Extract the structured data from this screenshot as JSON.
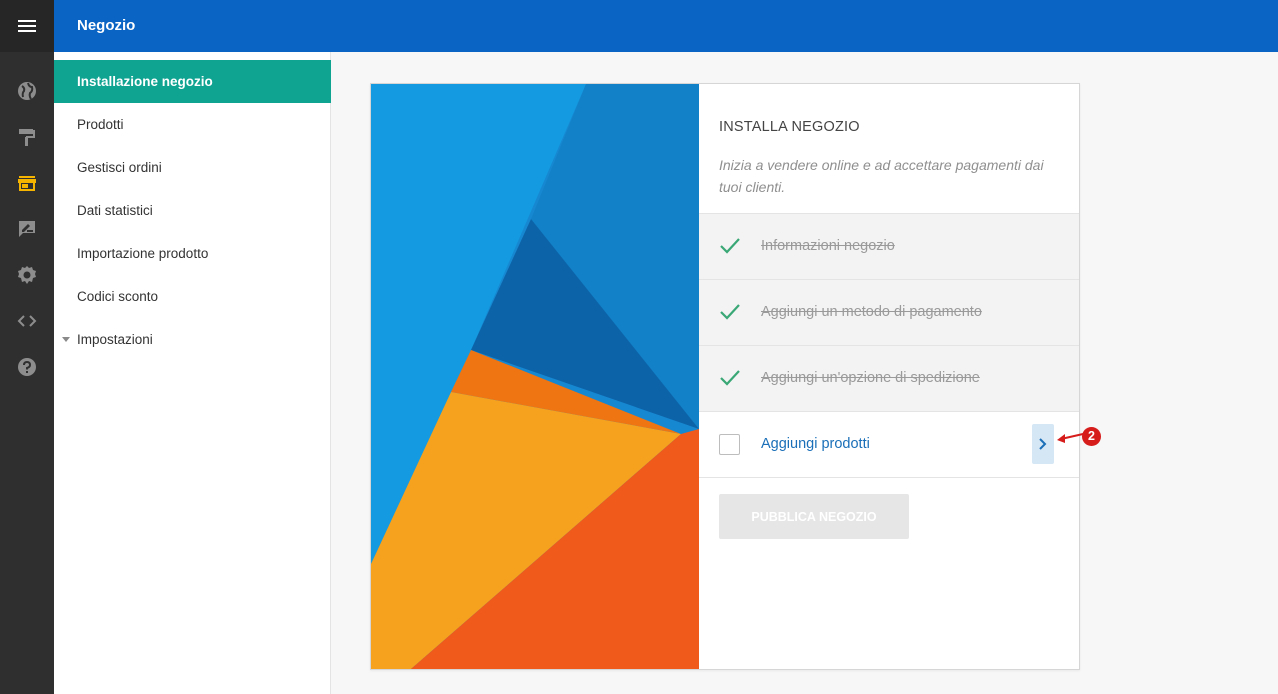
{
  "topbar": {
    "title": "Negozio"
  },
  "rail": {
    "items": [
      {
        "icon": "menu-icon"
      },
      {
        "icon": "globe-icon"
      },
      {
        "icon": "paint-roller-icon"
      },
      {
        "icon": "store-icon",
        "active": true,
        "color": "#f5b400"
      },
      {
        "icon": "edit-note-icon"
      },
      {
        "icon": "gear-icon"
      },
      {
        "icon": "code-icon"
      },
      {
        "icon": "help-icon"
      }
    ]
  },
  "sidebar": {
    "items": [
      {
        "label": "Installazione negozio",
        "active": true
      },
      {
        "label": "Prodotti"
      },
      {
        "label": "Gestisci ordini"
      },
      {
        "label": "Dati statistici"
      },
      {
        "label": "Importazione prodotto"
      },
      {
        "label": "Codici sconto"
      },
      {
        "label": "Impostazioni",
        "expandable": true
      }
    ]
  },
  "setup": {
    "title": "INSTALLA NEGOZIO",
    "description": "Inizia a vendere online e ad accettare pagamenti dai tuoi clienti.",
    "steps": [
      {
        "label": "Informazioni negozio",
        "done": true
      },
      {
        "label": "Aggiungi un metodo di pagamento",
        "done": true
      },
      {
        "label": "Aggiungi un'opzione di spedizione",
        "done": true
      },
      {
        "label": "Aggiungi prodotti",
        "done": false
      }
    ],
    "publish_label": "PUBBLICA NEGOZIO"
  },
  "annotation": {
    "badge": "2"
  },
  "colors": {
    "topbar": "#0a64c4",
    "rail": "#2f2f2f",
    "active_sidebar": "#0fa392",
    "check": "#3aa876",
    "link": "#1a6fb8",
    "annotation": "#d71c1c"
  }
}
